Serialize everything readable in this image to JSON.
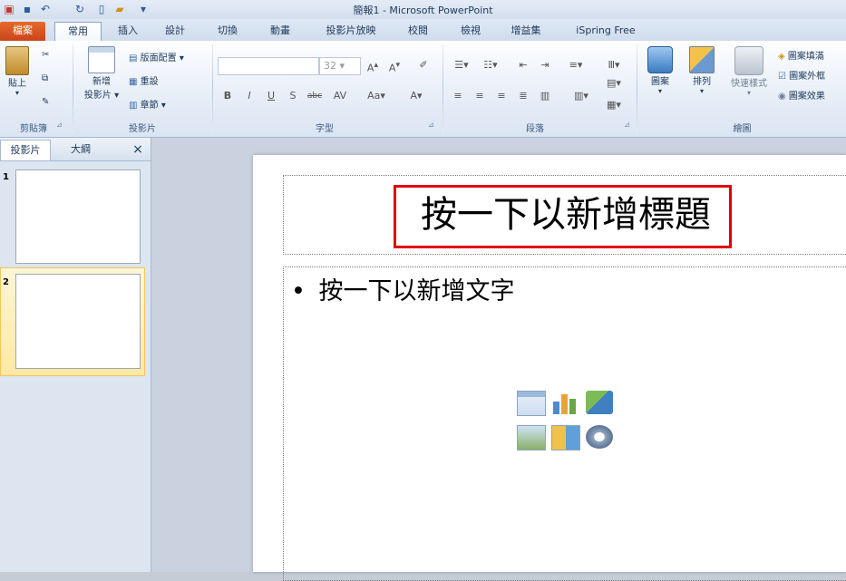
{
  "window": {
    "title": "簡報1 - Microsoft PowerPoint"
  },
  "tabs": [
    "檔案",
    "常用",
    "插入",
    "設計",
    "切換",
    "動畫",
    "投影片放映",
    "校閱",
    "檢視",
    "增益集",
    "iSpring Free"
  ],
  "ribbon": {
    "clipboard": {
      "paste": "貼上",
      "label": "剪貼簿"
    },
    "slides": {
      "new_slide_line1": "新增",
      "new_slide_line2": "投影片",
      "layout": "版面配置",
      "reset": "重設",
      "section": "章節",
      "label": "投影片"
    },
    "font": {
      "font_size": "32",
      "label": "字型"
    },
    "paragraph": {
      "label": "段落"
    },
    "drawing": {
      "shapes": "圖案",
      "arrange": "排列",
      "quick_styles": "快速樣式",
      "shape_fill": "圖案填滿",
      "shape_outline": "圖案外框",
      "shape_effects": "圖案效果",
      "label": "繪圖"
    }
  },
  "left_pane": {
    "tabs": [
      "投影片",
      "大綱"
    ],
    "close": "×",
    "slides": [
      {
        "number": "1"
      },
      {
        "number": "2"
      }
    ]
  },
  "slide": {
    "title_placeholder": "按一下以新增標題",
    "body_bullet": "•",
    "body_placeholder": "按一下以新增文字"
  },
  "colors": {
    "file_tab": "#d5531f",
    "highlight": "#e10000",
    "selected_thumb": "#ffe8a3"
  }
}
